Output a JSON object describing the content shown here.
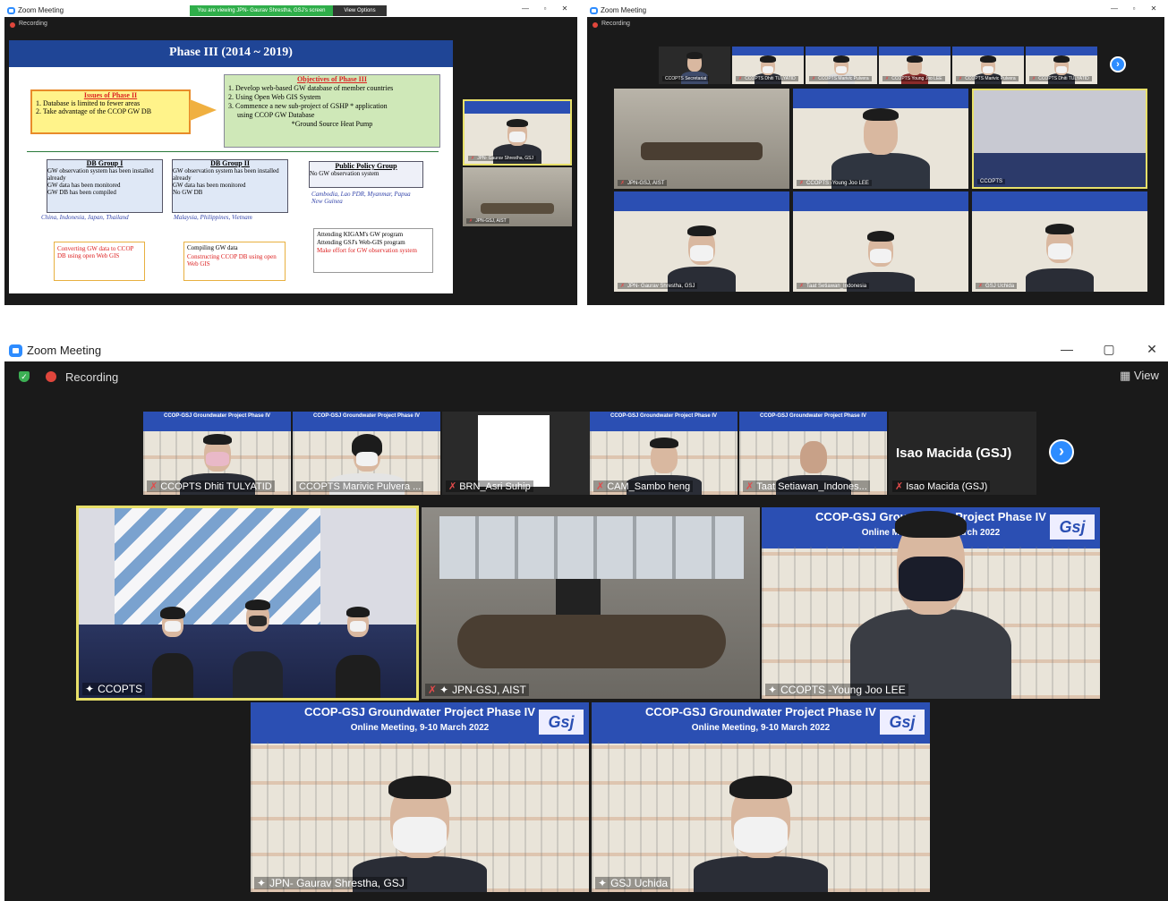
{
  "top_left": {
    "title": "Zoom Meeting",
    "banner": "You are viewing JPN- Gaurav Shrestha, GSJ's screen",
    "view_options": "View Options",
    "recording": "Recording",
    "slide": {
      "title": "Phase III (2014 ~ 2019)",
      "issues_title": "Issues of Phase II",
      "issues": [
        "1. Database is limited to fewer areas",
        "2. Take advantage of the CCOP GW DB"
      ],
      "objectives_title": "Objectives of Phase III",
      "objectives": [
        "1. Develop web-based GW database of member countries",
        "2. Using Open Web GIS System",
        "3. Commence a new sub-project of GSHP * application",
        "using CCOP GW Database",
        "*Ground Source Heat Pump"
      ],
      "group1_title": "DB Group I",
      "group1": [
        "GW observation system has been installed already",
        "GW data has been monitored",
        "GW DB has been compiled"
      ],
      "group1_countries": "China, Indonesia, Japan, Thailand",
      "group2_title": "DB Group II",
      "group2": [
        "GW observation system has been installed already",
        "GW data has been monitored",
        "No GW DB"
      ],
      "group2_countries": "Malaysia, Philippines, Vietnam",
      "group3_title": "Public Policy Group",
      "group3": [
        "No GW observation system"
      ],
      "group3_countries": "Cambodia, Lao PDR, Myanmar, Papua New Guinea",
      "action1": [
        "Converting GW data to CCOP DB using open Web GIS"
      ],
      "action2": [
        "Compiling GW data",
        "Constructing CCOP DB using open Web GIS"
      ],
      "action3": [
        "Attending KIGAM's GW program",
        "Attending GSJ's Web-GIS program",
        "Make effort for GW observation system"
      ]
    },
    "side_tiles": [
      "JPN- Gaurav Shrestha, GSJ",
      "JPN-GSJ, AIST"
    ]
  },
  "top_right": {
    "title": "Zoom Meeting",
    "recording": "Recording",
    "strip": [
      "CCOPTS Secretariat",
      "CCOPTS Dhiti TULYATID",
      "CCOPTS Marivic Pulvera",
      "CCOPTS Young Joo LEE",
      "CCOPTS Marivic Pulvera",
      "CCOPTS Dhiti TULYATID"
    ],
    "tiles": [
      "JPN-GSJ, AIST",
      "CCOPTS -Young Joo LEE",
      "CCOPTS",
      "JPN- Gaurav Shrestha, GSJ",
      "Taat Setiawan_Indonesia",
      "GSJ Uchida"
    ]
  },
  "main": {
    "title": "Zoom Meeting",
    "recording": "Recording",
    "view": "View",
    "minimize": "—",
    "close": "✕",
    "strip": [
      {
        "name": "CCOPTS Dhiti TULYATID",
        "kind": "ccop"
      },
      {
        "name": "CCOPTS Marivic Pulvera ...",
        "kind": "ccop"
      },
      {
        "name": "BRN_Asri Suhip",
        "kind": "blank"
      },
      {
        "name": "CAM_Sambo heng",
        "kind": "ccop"
      },
      {
        "name": "Taat Setiawan_Indones...",
        "kind": "ccop"
      }
    ],
    "name_only_tile": {
      "big": "Isao Macida (GSJ)",
      "label": "Isao Macida (GSJ)"
    },
    "next_arrow": "›",
    "tiles": [
      {
        "name": "CCOPTS"
      },
      {
        "name": "JPN-GSJ, AIST"
      },
      {
        "name": "CCOPTS -Young Joo LEE"
      },
      {
        "name": "JPN- Gaurav Shrestha, GSJ"
      },
      {
        "name": "GSJ Uchida"
      }
    ],
    "ccop_banner": {
      "line1": "CCOP-GSJ Groundwater Project Phase IV",
      "line2": "Online Meeting, 9-10 March 2022",
      "logo": "Gsj"
    }
  },
  "colors": {
    "zoom_blue": "#2d8cff",
    "active_border": "#e8e06a",
    "rec_red": "#e0463c",
    "banner_blue": "#2b4fb3"
  }
}
